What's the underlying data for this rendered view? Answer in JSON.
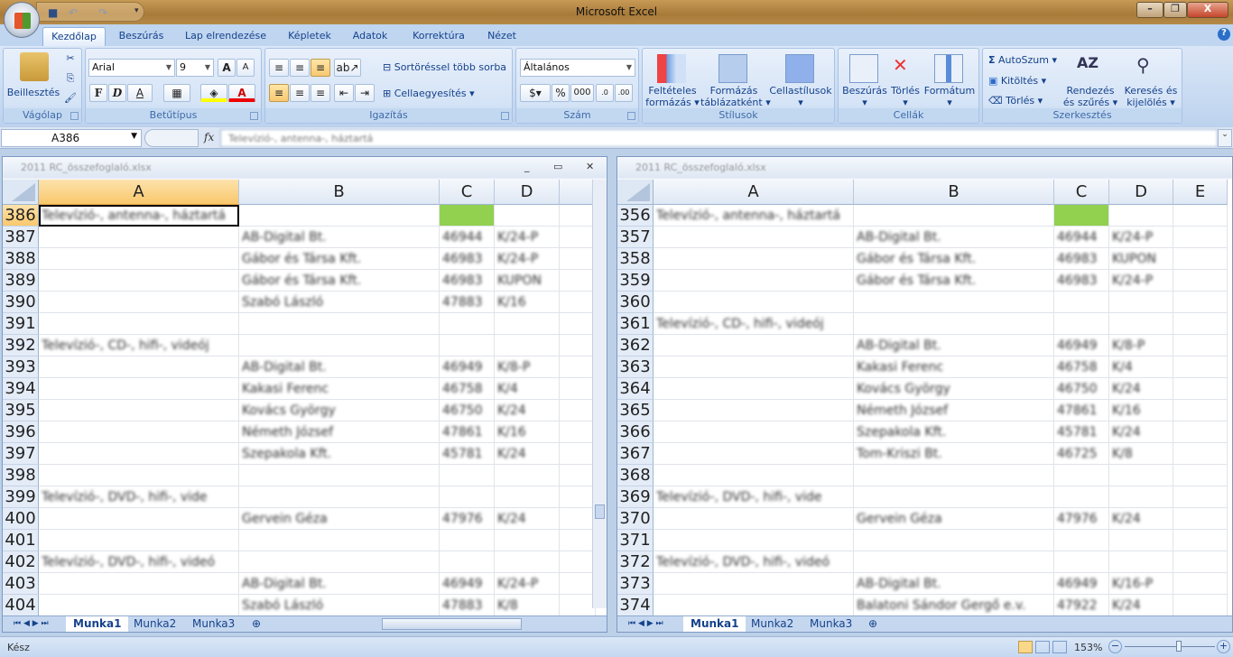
{
  "app": {
    "title": "Microsoft Excel"
  },
  "tabs": [
    "Kezdőlap",
    "Beszúrás",
    "Lap elrendezése",
    "Képletek",
    "Adatok",
    "Korrektúra",
    "Nézet"
  ],
  "ribbon": {
    "clipboard": {
      "label": "Vágólap",
      "paste": "Beillesztés"
    },
    "font": {
      "label": "Betűtípus",
      "name": "Arial",
      "size": "9",
      "bold": "F",
      "italic": "D",
      "underline": "A"
    },
    "alignment": {
      "label": "Igazítás",
      "wrap": "Sortöréssel több sorba",
      "merge": "Cellaegyesítés"
    },
    "number": {
      "label": "Szám",
      "format": "Általános",
      "percent": "%",
      "thousands": "000"
    },
    "styles": {
      "label": "Stílusok",
      "conditional1": "Feltételes",
      "conditional2": "formázás",
      "table1": "Formázás",
      "table2": "táblázatként",
      "cellstyles": "Cellastílusok"
    },
    "cells": {
      "label": "Cellák",
      "insert": "Beszúrás",
      "delete": "Törlés",
      "format": "Formátum"
    },
    "editing": {
      "label": "Szerkesztés",
      "autosum": "AutoSzum",
      "fill": "Kitöltés",
      "clear": "Törlés",
      "sort1": "Rendezés",
      "sort2": "és szűrés",
      "find1": "Keresés és",
      "find2": "kijelölés"
    }
  },
  "formula_bar": {
    "name_box": "A386",
    "fx": "fx",
    "value": "Televízió-, antenna-, háztartá"
  },
  "left_window": {
    "title": "2011 RC_összefoglaló.xlsx",
    "columns": [
      "A",
      "B",
      "C",
      "D"
    ],
    "rows": [
      {
        "n": "386",
        "a": "Televízió-, antenna-, háztartá",
        "b": "",
        "c": "",
        "d": "",
        "green": true
      },
      {
        "n": "387",
        "a": "",
        "b": "AB-Digital Bt.",
        "c": "46944",
        "d": "K/24-P"
      },
      {
        "n": "388",
        "a": "",
        "b": "Gábor és Társa Kft.",
        "c": "46983",
        "d": "K/24-P"
      },
      {
        "n": "389",
        "a": "",
        "b": "Gábor és Társa Kft.",
        "c": "46983",
        "d": "KUPON"
      },
      {
        "n": "390",
        "a": "",
        "b": "Szabó László",
        "c": "47883",
        "d": "K/16"
      },
      {
        "n": "391",
        "a": "",
        "b": "",
        "c": "",
        "d": ""
      },
      {
        "n": "392",
        "a": "Televízió-, CD-, hifi-, videój",
        "b": "",
        "c": "",
        "d": ""
      },
      {
        "n": "393",
        "a": "",
        "b": "AB-Digital Bt.",
        "c": "46949",
        "d": "K/8-P"
      },
      {
        "n": "394",
        "a": "",
        "b": "Kakasi Ferenc",
        "c": "46758",
        "d": "K/4"
      },
      {
        "n": "395",
        "a": "",
        "b": "Kovács György",
        "c": "46750",
        "d": "K/24"
      },
      {
        "n": "396",
        "a": "",
        "b": "Németh József",
        "c": "47861",
        "d": "K/16"
      },
      {
        "n": "397",
        "a": "",
        "b": "Szepakola Kft.",
        "c": "45781",
        "d": "K/24"
      },
      {
        "n": "398",
        "a": "",
        "b": "",
        "c": "",
        "d": ""
      },
      {
        "n": "399",
        "a": "Televízió-, DVD-, hifi-, vide",
        "b": "",
        "c": "",
        "d": ""
      },
      {
        "n": "400",
        "a": "",
        "b": "Gervein Géza",
        "c": "47976",
        "d": "K/24"
      },
      {
        "n": "401",
        "a": "",
        "b": "",
        "c": "",
        "d": ""
      },
      {
        "n": "402",
        "a": "Televízió-, DVD-, hifi-, videó",
        "b": "",
        "c": "",
        "d": ""
      },
      {
        "n": "403",
        "a": "",
        "b": "AB-Digital Bt.",
        "c": "46949",
        "d": "K/24-P"
      },
      {
        "n": "404",
        "a": "",
        "b": "Szabó László",
        "c": "47883",
        "d": "K/8"
      }
    ],
    "sheets": [
      "Munka1",
      "Munka2",
      "Munka3"
    ]
  },
  "right_window": {
    "title": "2011 RC_összefoglaló.xlsx",
    "columns": [
      "A",
      "B",
      "C",
      "D",
      "E"
    ],
    "rows": [
      {
        "n": "356",
        "a": "Televízió-, antenna-, háztartá",
        "b": "",
        "c": "",
        "d": "",
        "green": true
      },
      {
        "n": "357",
        "a": "",
        "b": "AB-Digital Bt.",
        "c": "46944",
        "d": "K/24-P"
      },
      {
        "n": "358",
        "a": "",
        "b": "Gábor és Társa Kft.",
        "c": "46983",
        "d": "KUPON"
      },
      {
        "n": "359",
        "a": "",
        "b": "Gábor és Társa Kft.",
        "c": "46983",
        "d": "K/24-P"
      },
      {
        "n": "360",
        "a": "",
        "b": "",
        "c": "",
        "d": ""
      },
      {
        "n": "361",
        "a": "Televízió-, CD-, hifi-, videój",
        "b": "",
        "c": "",
        "d": ""
      },
      {
        "n": "362",
        "a": "",
        "b": "AB-Digital Bt.",
        "c": "46949",
        "d": "K/8-P"
      },
      {
        "n": "363",
        "a": "",
        "b": "Kakasi Ferenc",
        "c": "46758",
        "d": "K/4"
      },
      {
        "n": "364",
        "a": "",
        "b": "Kovács György",
        "c": "46750",
        "d": "K/24"
      },
      {
        "n": "365",
        "a": "",
        "b": "Németh József",
        "c": "47861",
        "d": "K/16"
      },
      {
        "n": "366",
        "a": "",
        "b": "Szepakola Kft.",
        "c": "45781",
        "d": "K/24"
      },
      {
        "n": "367",
        "a": "",
        "b": "Tom-Kriszi Bt.",
        "c": "46725",
        "d": "K/8"
      },
      {
        "n": "368",
        "a": "",
        "b": "",
        "c": "",
        "d": ""
      },
      {
        "n": "369",
        "a": "Televízió-, DVD-, hifi-, vide",
        "b": "",
        "c": "",
        "d": ""
      },
      {
        "n": "370",
        "a": "",
        "b": "Gervein Géza",
        "c": "47976",
        "d": "K/24"
      },
      {
        "n": "371",
        "a": "",
        "b": "",
        "c": "",
        "d": ""
      },
      {
        "n": "372",
        "a": "Televízió-, DVD-, hifi-, videó",
        "b": "",
        "c": "",
        "d": ""
      },
      {
        "n": "373",
        "a": "",
        "b": "AB-Digital Bt.",
        "c": "46949",
        "d": "K/16-P"
      },
      {
        "n": "374",
        "a": "",
        "b": "Balatoni Sándor Gergő e.v.",
        "c": "47922",
        "d": "K/24"
      }
    ],
    "sheets": [
      "Munka1",
      "Munka2",
      "Munka3"
    ]
  },
  "status": {
    "text": "Kész",
    "zoom": "153%",
    "zoom_fraction": 0.6
  }
}
